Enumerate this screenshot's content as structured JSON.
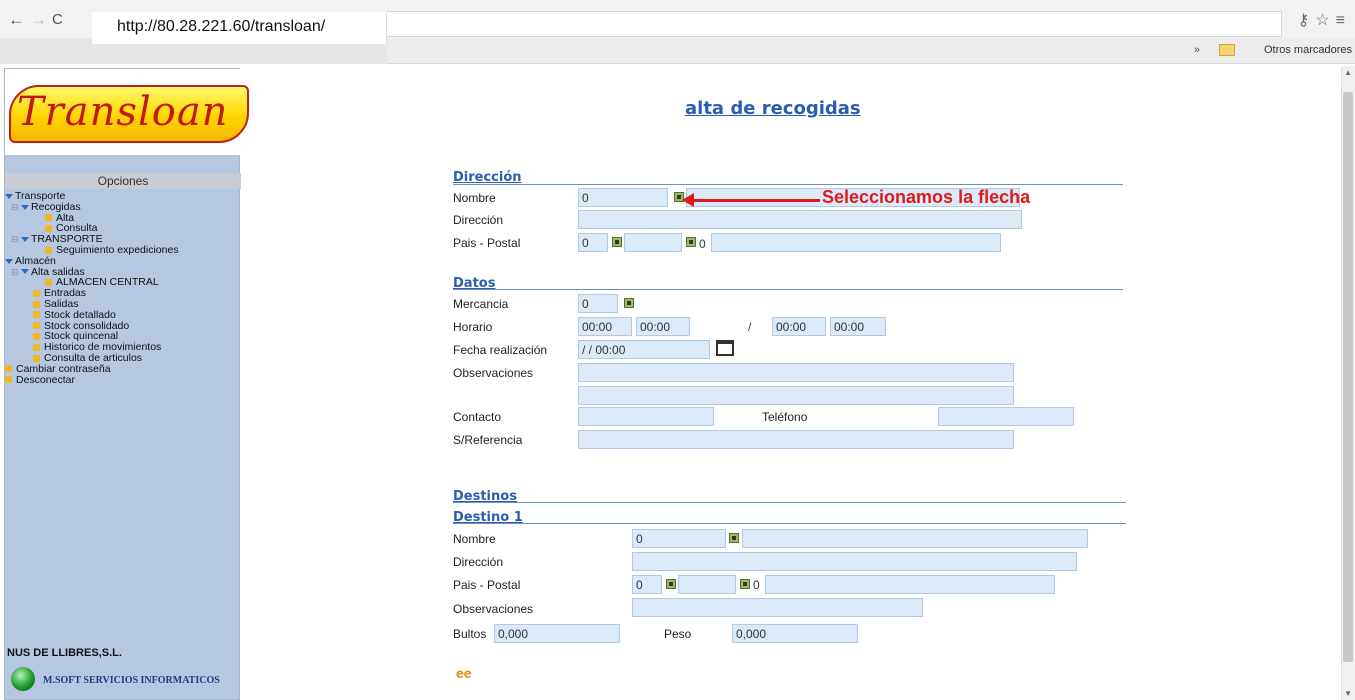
{
  "browser": {
    "url": "http://80.28.221.60/transloan/",
    "bookmarks_chevron": "»",
    "bookmarks_folder": "Otros marcadores"
  },
  "sidebar": {
    "logo_text": "Transloan",
    "options_header": "Opciones",
    "tree": [
      {
        "label": "Transporte",
        "kind": "folder",
        "level": 0
      },
      {
        "label": "Recogidas",
        "kind": "folder",
        "level": 1
      },
      {
        "label": "Alta",
        "kind": "leaf",
        "level": 2
      },
      {
        "label": "Consulta",
        "kind": "leaf",
        "level": 2
      },
      {
        "label": "TRANSPORTE",
        "kind": "folder",
        "level": 1
      },
      {
        "label": "Seguimiento expediciones",
        "kind": "leaf",
        "level": 2
      },
      {
        "label": "Almacén",
        "kind": "folder",
        "level": 0
      },
      {
        "label": "Alta salidas",
        "kind": "folder",
        "level": 1
      },
      {
        "label": "ALMACEN CENTRAL",
        "kind": "leaf",
        "level": 2
      },
      {
        "label": "Entradas",
        "kind": "leaf",
        "level": 1
      },
      {
        "label": "Salidas",
        "kind": "leaf",
        "level": 1
      },
      {
        "label": "Stock detallado",
        "kind": "leaf",
        "level": 1
      },
      {
        "label": "Stock consolidado",
        "kind": "leaf",
        "level": 1
      },
      {
        "label": "Stock quincenal",
        "kind": "leaf",
        "level": 1
      },
      {
        "label": "Historico de movimientos",
        "kind": "leaf",
        "level": 1
      },
      {
        "label": "Consulta de articulos",
        "kind": "leaf",
        "level": 1
      },
      {
        "label": "Cambiar contraseña",
        "kind": "leaf",
        "level": 0
      },
      {
        "label": "Desconectar",
        "kind": "leaf",
        "level": 0
      }
    ],
    "company": "NUS DE LLIBRES,S.L.",
    "provider": "M.SOFT SERVICIOS INFORMATICOS"
  },
  "form": {
    "title": "alta de recogidas",
    "direccion": {
      "heading": "Dirección",
      "nombre_label": "Nombre",
      "nombre_code": "0",
      "direccion_label": "Dirección",
      "pais_label": "Pais - Postal",
      "pais_code": "0",
      "postal_code": "0"
    },
    "datos": {
      "heading": "Datos",
      "mercancia_label": "Mercancia",
      "mercancia_value": "0",
      "horario_label": "Horario",
      "horario": [
        "00:00",
        "00:00",
        "00:00",
        "00:00"
      ],
      "horario_sep": "/",
      "fecha_label": "Fecha realización",
      "fecha_value": "/ /  00:00",
      "observaciones_label": "Observaciones",
      "contacto_label": "Contacto",
      "telefono_label": "Teléfono",
      "referencia_label": "S/Referencia"
    },
    "destinos": {
      "heading": "Destinos",
      "destino_heading": "Destino 1",
      "nombre_label": "Nombre",
      "nombre_code": "0",
      "direccion_label": "Dirección",
      "pais_label": "Pais - Postal",
      "pais_code": "0",
      "postal_code": "0",
      "observaciones_label": "Observaciones",
      "bultos_label": "Bultos",
      "bultos_value": "0,000",
      "peso_label": "Peso",
      "peso_value": "0,000"
    },
    "go_symbol": "ee"
  },
  "annotation": {
    "text": "Seleccionamos la flecha",
    "color": "#e01a1a"
  }
}
